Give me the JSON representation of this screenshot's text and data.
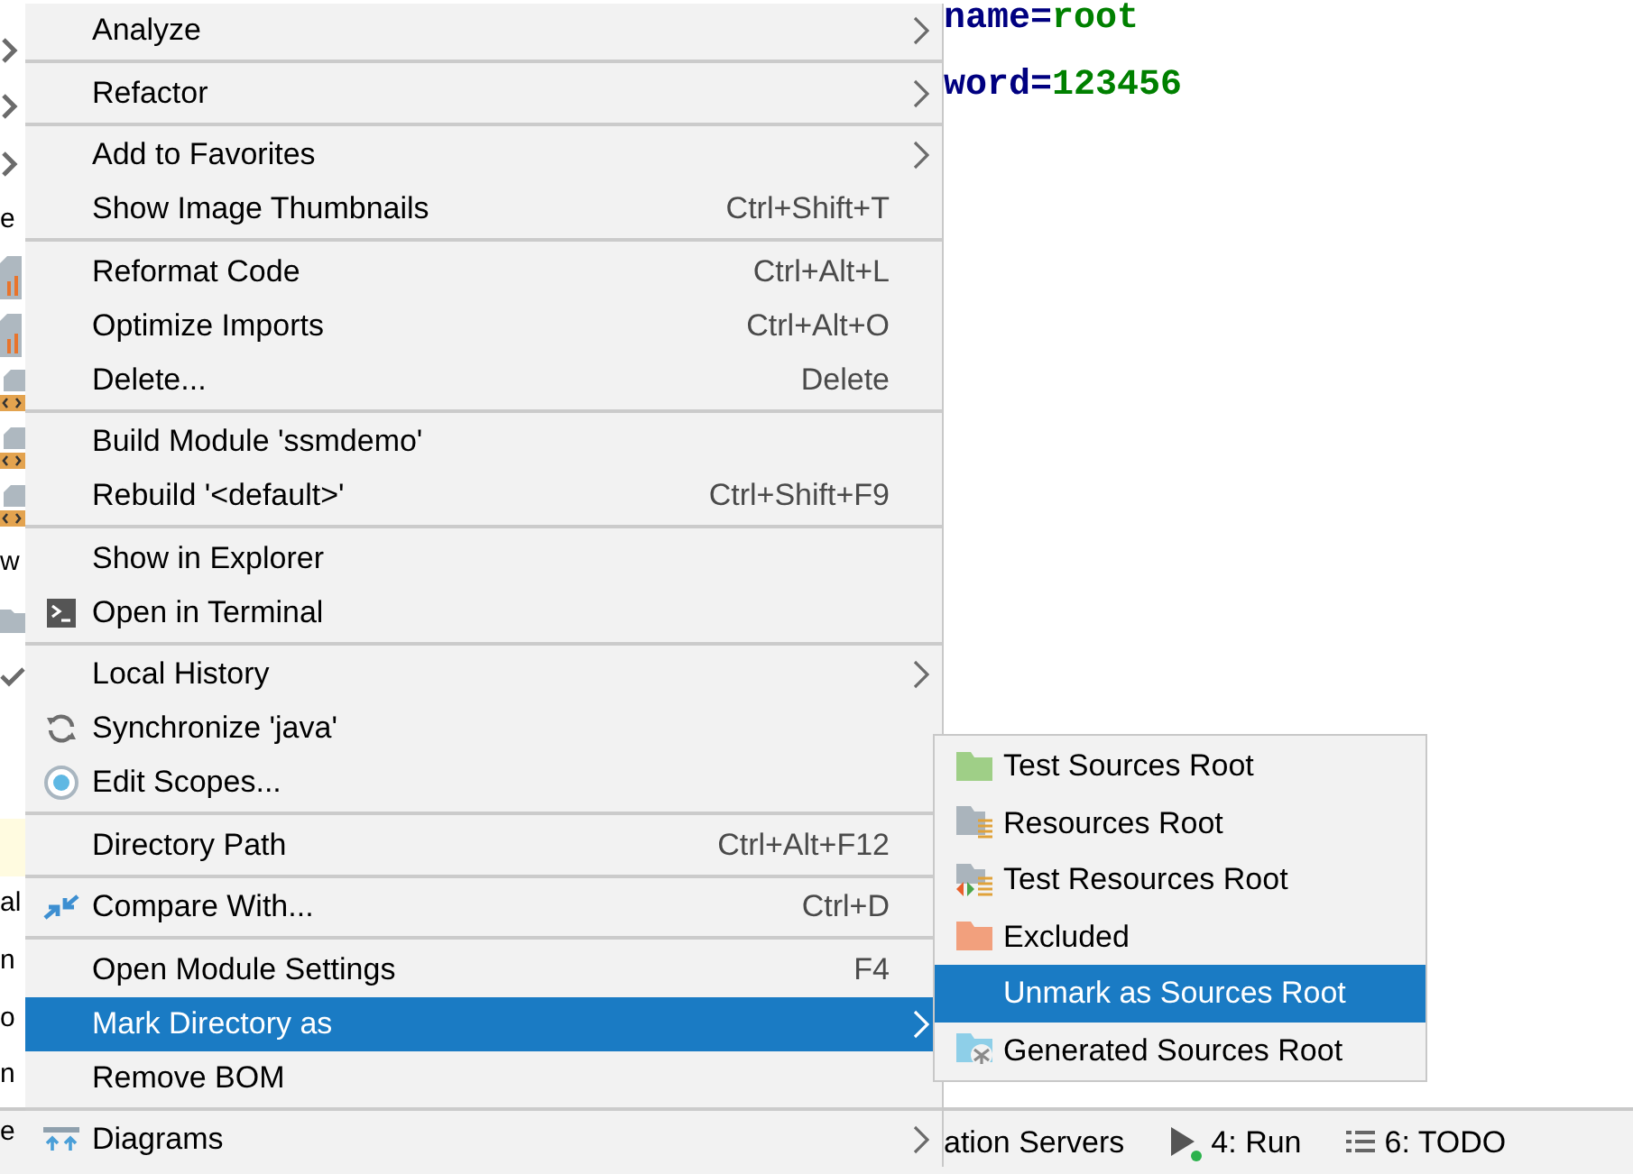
{
  "tree_fragments": [
    {
      "kind": "chevron"
    },
    {
      "kind": "chevron"
    },
    {
      "kind": "chevron"
    },
    {
      "kind": "text",
      "text": "e"
    },
    {
      "kind": "file"
    },
    {
      "kind": "file"
    },
    {
      "kind": "xml"
    },
    {
      "kind": "xml"
    },
    {
      "kind": "xml"
    },
    {
      "kind": "text",
      "text": "w"
    },
    {
      "kind": "folder"
    },
    {
      "kind": "check"
    },
    {
      "kind": "blank"
    },
    {
      "kind": "blank"
    },
    {
      "kind": "highlight"
    },
    {
      "kind": "text",
      "text": "al"
    },
    {
      "kind": "text",
      "text": "n"
    },
    {
      "kind": "text",
      "text": "o"
    },
    {
      "kind": "text",
      "text": "n"
    },
    {
      "kind": "text",
      "text": "e"
    }
  ],
  "editor_lines": [
    {
      "key": "name",
      "op": "=",
      "value": "root"
    },
    {
      "key": "word",
      "op": "=",
      "value": "123456"
    }
  ],
  "status_bar": {
    "items": [
      {
        "kind": "text",
        "label": "ation Servers"
      },
      {
        "kind": "run",
        "label": "4: Run"
      },
      {
        "kind": "todo",
        "label": "6: TODO"
      }
    ]
  },
  "context_menu": {
    "groups": [
      [
        {
          "label": "Analyze",
          "submenu": true,
          "selected": false
        }
      ],
      [
        {
          "label": "Refactor",
          "submenu": true,
          "selected": false
        }
      ],
      [
        {
          "label": "Add to Favorites",
          "submenu": true,
          "selected": false
        },
        {
          "label": "Show Image Thumbnails",
          "shortcut": "Ctrl+Shift+T",
          "selected": false
        }
      ],
      [
        {
          "label": "Reformat Code",
          "shortcut": "Ctrl+Alt+L",
          "selected": false
        },
        {
          "label": "Optimize Imports",
          "shortcut": "Ctrl+Alt+O",
          "selected": false
        },
        {
          "label": "Delete...",
          "shortcut": "Delete",
          "selected": false
        }
      ],
      [
        {
          "label": "Build Module 'ssmdemo'",
          "selected": false
        },
        {
          "label": "Rebuild '<default>'",
          "shortcut": "Ctrl+Shift+F9",
          "selected": false
        }
      ],
      [
        {
          "label": "Show in Explorer",
          "selected": false
        },
        {
          "label": "Open in Terminal",
          "kind": "terminal",
          "selected": false
        }
      ],
      [
        {
          "label": "Local History",
          "submenu": true,
          "selected": false
        },
        {
          "label": "Synchronize 'java'",
          "kind": "sync",
          "selected": false
        },
        {
          "label": "Edit Scopes...",
          "kind": "scope",
          "selected": false
        }
      ],
      [
        {
          "label": "Directory Path",
          "shortcut": "Ctrl+Alt+F12",
          "selected": false
        }
      ],
      [
        {
          "label": "Compare With...",
          "kind": "compare",
          "shortcut": "Ctrl+D",
          "selected": false
        }
      ],
      [
        {
          "label": "Open Module Settings",
          "shortcut": "F4",
          "selected": false
        },
        {
          "label": "Mark Directory as",
          "submenu": true,
          "selected": true
        },
        {
          "label": "Remove BOM",
          "selected": false
        }
      ],
      [
        {
          "label": "Diagrams",
          "kind": "diagram",
          "submenu": true,
          "selected": false
        }
      ]
    ]
  },
  "submenu": {
    "items": [
      {
        "label": "Test Sources Root",
        "kind": "tests",
        "selected": false
      },
      {
        "label": "Resources Root",
        "kind": "resources",
        "selected": false
      },
      {
        "label": "Test Resources Root",
        "kind": "testresources",
        "selected": false
      },
      {
        "label": "Excluded",
        "kind": "excluded",
        "selected": false
      },
      {
        "label": "Unmark as Sources Root",
        "selected": true
      },
      {
        "label": "Generated Sources Root",
        "kind": "generated",
        "selected": false
      }
    ]
  }
}
